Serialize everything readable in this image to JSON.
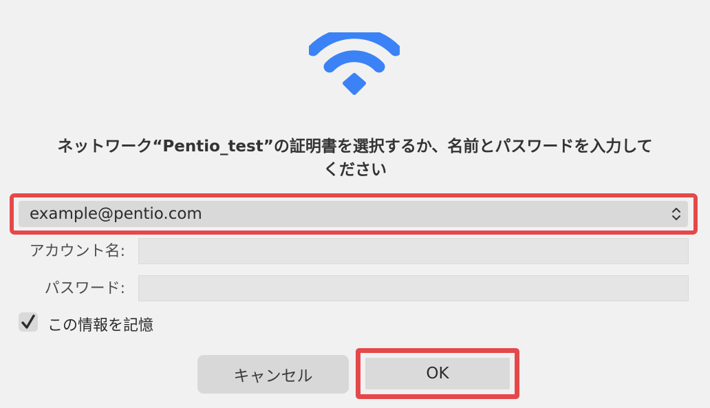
{
  "dialog": {
    "icon": "wifi-icon",
    "prompt_line1": "ネットワーク“Pentio_test”の証明書を選択するか、名前とパスワードを入力して",
    "prompt_line2": "ください",
    "accent_color": "#3b82f6",
    "highlight_color": "#e5484a"
  },
  "certificate": {
    "selected": "example@pentio.com"
  },
  "form": {
    "account_label": "アカウント名:",
    "account_value": "",
    "password_label": "パスワード:",
    "password_value": ""
  },
  "remember": {
    "label": "この情報を記憶",
    "checked": true
  },
  "buttons": {
    "cancel": "キャンセル",
    "ok": "OK"
  }
}
